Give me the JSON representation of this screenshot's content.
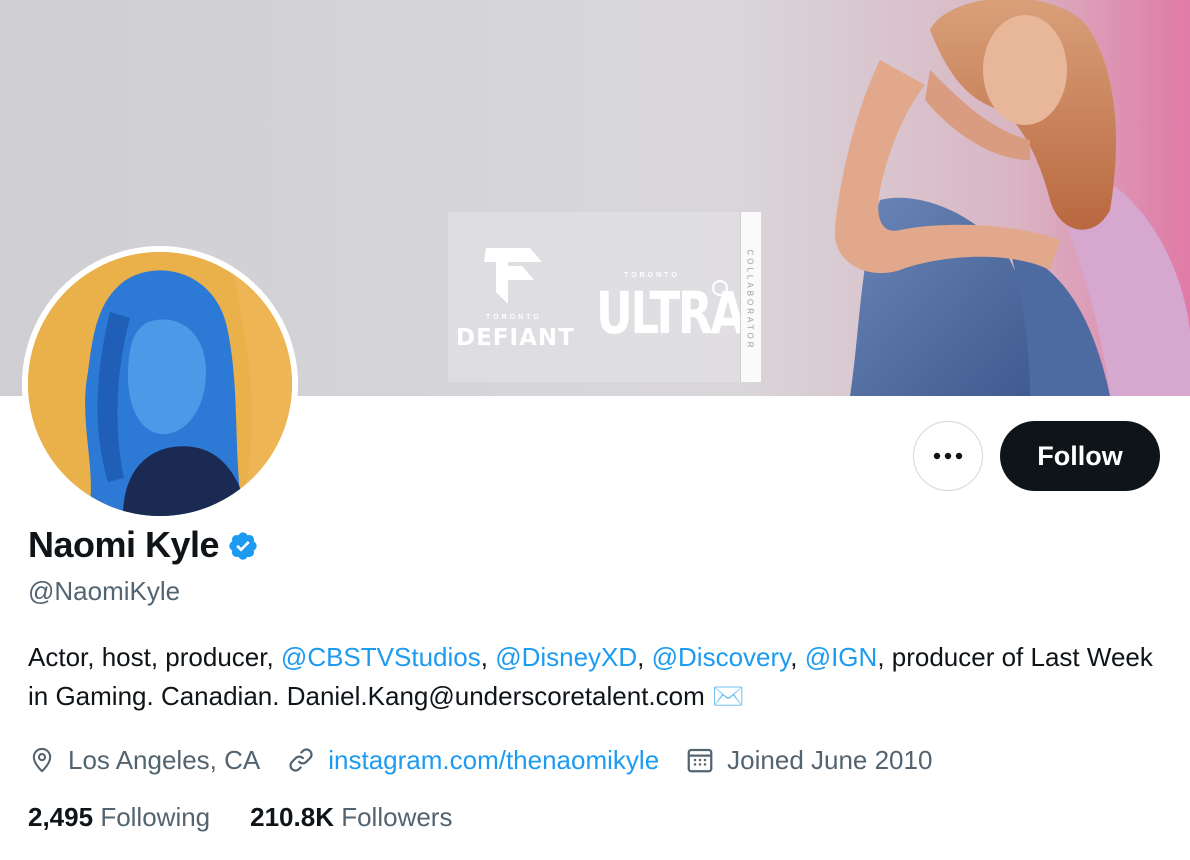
{
  "profile": {
    "name": "Naomi Kyle",
    "handle": "@NaomiKyle",
    "verified_icon": "verified-badge-icon",
    "bio": {
      "prefix": "Actor, host, producer, ",
      "mention1": "@CBSTVStudios",
      "sep1": ", ",
      "mention2": "@DisneyXD",
      "sep2": ", ",
      "mention3": "@Discovery",
      "sep3": ", ",
      "mention4": "@IGN",
      "suffix": ", producer of Last Week in Gaming. Canadian. Daniel.Kang@underscoretalent.com ",
      "emoji": "✉️"
    },
    "location": "Los Angeles, CA",
    "website": "instagram.com/thenaomikyle",
    "joined": "Joined June 2010",
    "following_count": "2,495",
    "following_label": "Following",
    "followers_count": "210.8K",
    "followers_label": "Followers"
  },
  "actions": {
    "more_label": "•••",
    "follow_label": "Follow"
  },
  "banner": {
    "defiant_small": "TORONTO",
    "defiant": "DEFIANT",
    "ultra_small": "TORONTO",
    "ultra": "ULTRA",
    "collab": "COLLABORATOR"
  },
  "colors": {
    "accent": "#1d9bf0",
    "text_primary": "#0f1419",
    "text_secondary": "#536471",
    "follow_bg": "#0f1419"
  }
}
